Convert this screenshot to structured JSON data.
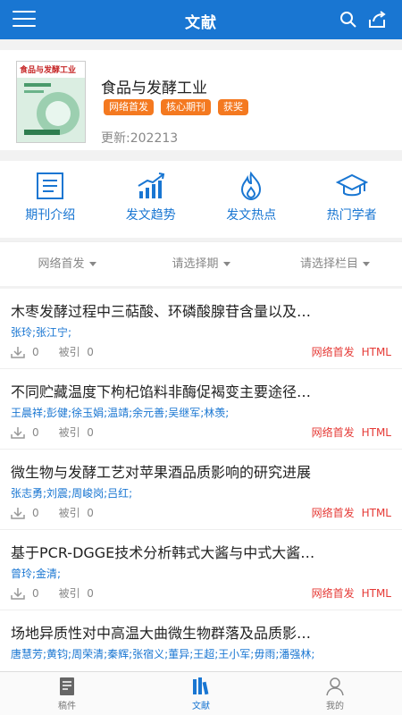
{
  "topbar": {
    "title": "文献"
  },
  "journal": {
    "cover_title": "食品与发酵工业",
    "name": "食品与发酵工业",
    "tags": [
      "网络首发",
      "核心期刊",
      "获奖"
    ],
    "updated": "更新:202213"
  },
  "quicknav": [
    {
      "label": "期刊介绍",
      "icon": "document-icon"
    },
    {
      "label": "发文趋势",
      "icon": "trend-chart-icon"
    },
    {
      "label": "发文热点",
      "icon": "flame-icon"
    },
    {
      "label": "热门学者",
      "icon": "graduation-cap-icon"
    }
  ],
  "filters": [
    "网络首发",
    "请选择期",
    "请选择栏目"
  ],
  "articles": [
    {
      "title": "木枣发酵过程中三萜酸、环磷酸腺苷含量以及…",
      "authors": "张玲;张江宁;",
      "downloads": "0",
      "cited_label": "被引",
      "cited": "0",
      "badge": "网络首发",
      "format": "HTML"
    },
    {
      "title": "不同贮藏温度下枸杞馅料非酶促褐变主要途径…",
      "authors": "王晨祥;彭健;徐玉娟;温靖;余元善;吴继军;林羡;",
      "downloads": "0",
      "cited_label": "被引",
      "cited": "0",
      "badge": "网络首发",
      "format": "HTML"
    },
    {
      "title": "微生物与发酵工艺对苹果酒品质影响的研究进展",
      "authors": "张志勇;刘震;周峻岗;吕红;",
      "downloads": "0",
      "cited_label": "被引",
      "cited": "0",
      "badge": "网络首发",
      "format": "HTML"
    },
    {
      "title": "基于PCR-DGGE技术分析韩式大酱与中式大酱…",
      "authors": "曾玲;金清;",
      "downloads": "0",
      "cited_label": "被引",
      "cited": "0",
      "badge": "网络首发",
      "format": "HTML"
    },
    {
      "title": "场地异质性对中高温大曲微生物群落及品质影…",
      "authors": "唐慧芳;黄钧;周荣清;秦辉;张宿义;董异;王超;王小军;毋雨;潘强林;",
      "downloads": "",
      "cited_label": "",
      "cited": "",
      "badge": "",
      "format": ""
    }
  ],
  "bottomnav": [
    {
      "label": "稿件",
      "icon": "manuscript-icon",
      "active": false
    },
    {
      "label": "文献",
      "icon": "literature-icon",
      "active": true
    },
    {
      "label": "我的",
      "icon": "profile-icon",
      "active": false
    }
  ],
  "colors": {
    "primary": "#1976d2",
    "tag": "#f47920",
    "badge": "#e53935"
  }
}
